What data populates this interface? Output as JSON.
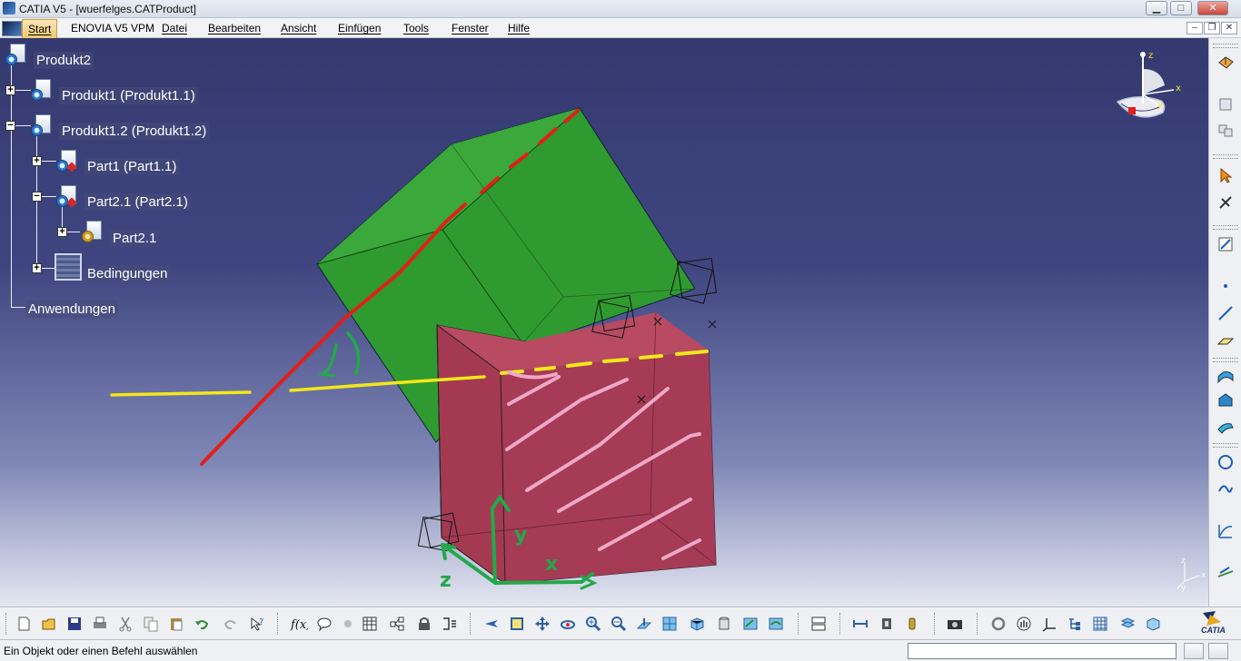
{
  "window": {
    "title": "CATIA V5 - [wuerfelges.CATProduct]",
    "controls": {
      "minimize": "▁",
      "maximize": "□",
      "close": "✕"
    }
  },
  "menubar": {
    "items": [
      "Start",
      "ENOVIA V5 VPM",
      "Datei",
      "Bearbeiten",
      "Ansicht",
      "Einfügen",
      "Tools",
      "Fenster",
      "Hilfe"
    ],
    "mdi_controls": {
      "minimize": "–",
      "restore": "❐",
      "close": "✕"
    }
  },
  "spec_tree": {
    "nodes": [
      {
        "label": "Produkt2",
        "icon": "product-icon",
        "expander": ""
      },
      {
        "label": "Produkt1 (Produkt1.1)",
        "icon": "product-icon",
        "expander": "+"
      },
      {
        "label": "Produkt1.2 (Produkt1.2)",
        "icon": "product-icon",
        "expander": "−"
      },
      {
        "label": "Part1 (Part1.1)",
        "icon": "part-icon",
        "expander": "+"
      },
      {
        "label": "Part2.1 (Part2.1)",
        "icon": "part-icon",
        "expander": "−"
      },
      {
        "label": "Part2.1",
        "icon": "part-body-icon",
        "expander": "+"
      },
      {
        "label": "Bedingungen",
        "icon": "constraints-icon",
        "expander": "+"
      },
      {
        "label": "Anwendungen",
        "icon": "",
        "expander": ""
      }
    ]
  },
  "compass": {
    "x": "x",
    "y": "y",
    "z": "z"
  },
  "mini_axis": {
    "x": "x",
    "y": "y",
    "z": "z"
  },
  "annotations": {
    "green_arrow_labels": [
      "z",
      "y",
      "x"
    ]
  },
  "right_toolbar": {
    "icons": [
      "render-style-icon",
      "cube-stack-icon",
      "assembly-icon",
      "select-arrow-icon",
      "snap-icon",
      "sketch-icon",
      "point-icon",
      "line-icon",
      "plane-icon",
      "surface-icon",
      "fill-icon",
      "extrude-icon",
      "circle-icon",
      "spline-icon",
      "curve-icon",
      "law-icon"
    ]
  },
  "bottom_toolbar": {
    "icons": [
      "new-icon",
      "open-icon",
      "save-icon",
      "print-icon",
      "cut-icon",
      "copy-icon",
      "paste-icon",
      "undo-icon",
      "redo-icon",
      "whats-this-icon",
      "formula-icon",
      "comment-icon",
      "design-table-icon",
      "catalog-icon",
      "tree-icon",
      "lock-icon",
      "knowledge-icon",
      "fly-mode-icon",
      "fit-all-icon",
      "pan-icon",
      "rotate-icon",
      "zoom-in-icon",
      "zoom-out-icon",
      "normal-view-icon",
      "multi-view-icon",
      "iso-view-icon",
      "shading-icon",
      "hide-show-icon",
      "swap-visible-icon",
      "snapshot-icon",
      "measure-icon",
      "inertia-icon",
      "analysis-icon",
      "camera-icon",
      "update-icon",
      "hand-icon",
      "axis-icon",
      "spec-tree-icon",
      "grid-icon",
      "layer-icon",
      "cube-view-icon"
    ],
    "logo_text": "CATIA"
  },
  "statusbar": {
    "message": "Ein Objekt oder einen Befehl auswählen",
    "command_value": "",
    "command_placeholder": ""
  },
  "colors": {
    "viewport_top": "#343a6f",
    "viewport_bottom": "#e4e6f1",
    "green_cube": "#2e9a2e",
    "red_cube": "#a23a52",
    "annotation_red": "#e0201a",
    "annotation_yellow": "#f2e81b",
    "annotation_green": "#23a84a",
    "annotation_pink": "#f0a8c8"
  }
}
